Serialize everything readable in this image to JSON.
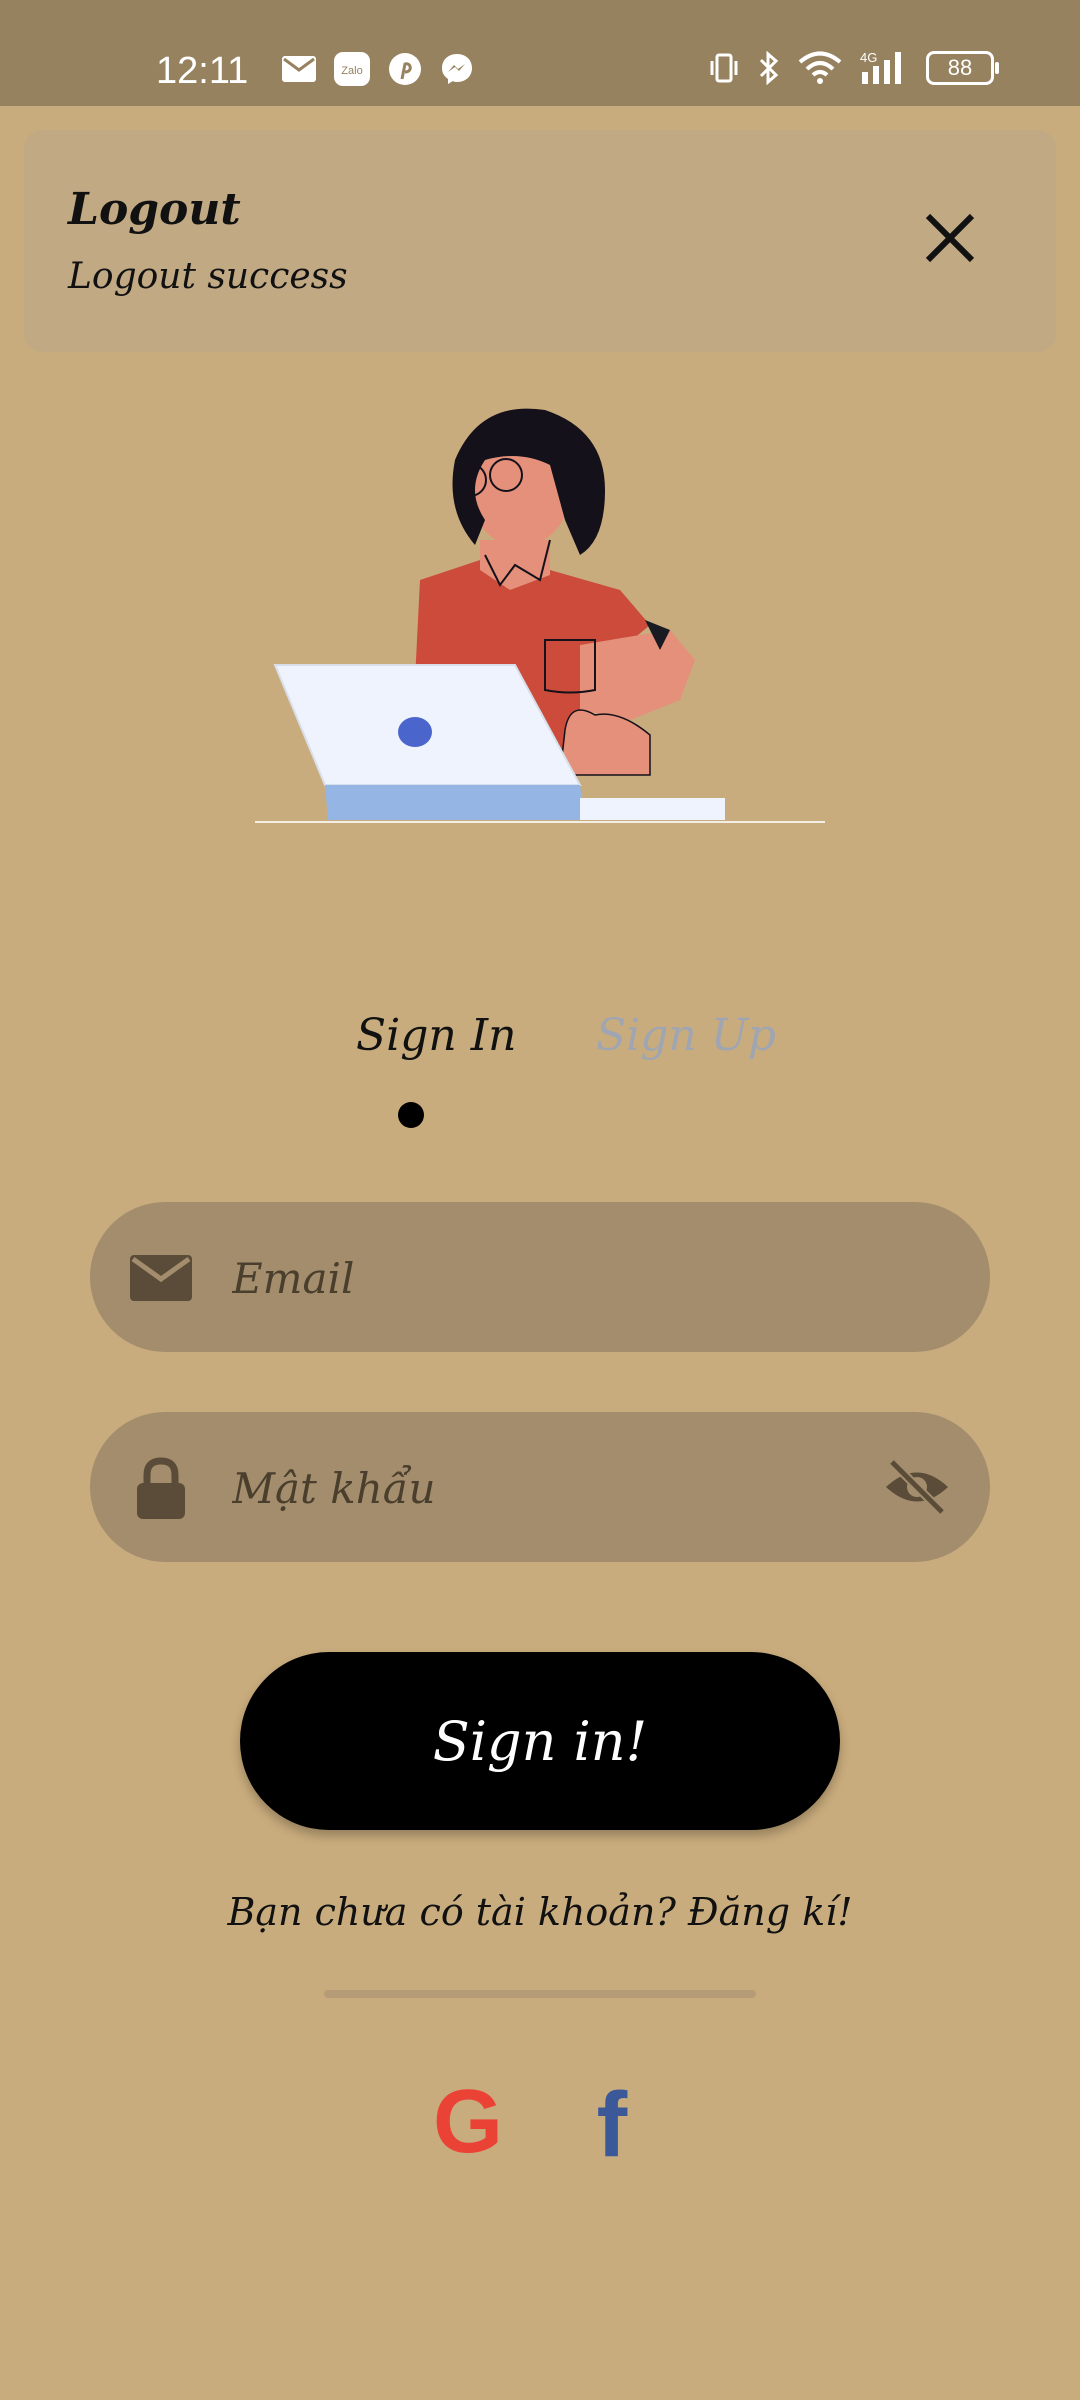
{
  "status_bar": {
    "time": "12:11",
    "notification_icons": [
      "mail-icon",
      "zalo-icon",
      "pinterest-icon",
      "messenger-icon"
    ],
    "zalo_label": "Zalo",
    "system_icons": [
      "vibrate-icon",
      "bluetooth-icon",
      "wifi-icon",
      "signal-4g-icon"
    ],
    "network_label": "4G",
    "battery": "88"
  },
  "toast": {
    "title": "Logout",
    "message": "Logout success"
  },
  "tabs": {
    "sign_in": "Sign In",
    "sign_up": "Sign Up",
    "active": "sign_in"
  },
  "form": {
    "email_placeholder": "Email",
    "email_value": "",
    "password_placeholder": "Mật khẩu",
    "password_value": "",
    "submit_label": "Sign in!"
  },
  "register": {
    "prompt": "Bạn chưa có tài khoản?",
    "link": "Đăng kí!"
  },
  "social": {
    "google_label": "G",
    "facebook_label": "f"
  },
  "colors": {
    "background": "#C9AC7D",
    "status_bar": "#978260",
    "toast": "#C1A984",
    "field": "#A38D6D",
    "google": "#EA4335",
    "facebook": "#3B5998",
    "inactive_tab": "#9FA6B1"
  }
}
